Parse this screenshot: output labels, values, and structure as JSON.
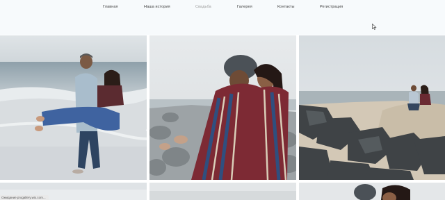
{
  "nav": {
    "items": [
      {
        "label": "Главная",
        "active": false
      },
      {
        "label": "Наша история",
        "active": false
      },
      {
        "label": "Свадьба",
        "active": true
      },
      {
        "label": "Галерея",
        "active": false
      },
      {
        "label": "Контакты",
        "active": false
      },
      {
        "label": "Регистрация",
        "active": false
      }
    ]
  },
  "gallery": {
    "photos": [
      {
        "name": "photo-couple-beach-carry"
      },
      {
        "name": "photo-couple-blanket"
      },
      {
        "name": "photo-couple-rocks"
      },
      {
        "name": "photo-row2-1"
      },
      {
        "name": "photo-row2-2"
      },
      {
        "name": "photo-row2-3"
      }
    ]
  },
  "status_bar": {
    "text": "Ожидание progallery.wix.com..."
  },
  "colors": {
    "accent_inactive": "#9a9a9a",
    "nav_text": "#3b3b3b",
    "header_bg": "#f7fafc"
  }
}
